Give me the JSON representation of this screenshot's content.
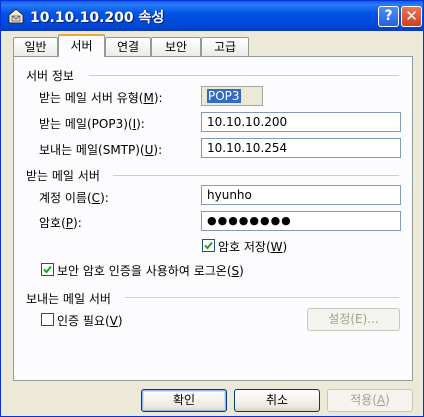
{
  "window": {
    "title": "10.10.10.200 속성",
    "help_glyph": "?",
    "close_glyph": "✕"
  },
  "tabs": [
    "일반",
    "서버",
    "연결",
    "보안",
    "고급"
  ],
  "server_info": {
    "heading": "서버 정보",
    "incoming_type": {
      "label_pre": "받는 메일 서버 유형(",
      "key": "M",
      "label_post": "):",
      "value": "POP3"
    },
    "incoming": {
      "label_pre": "받는 메일(POP3)(",
      "key": "I",
      "label_post": "):",
      "value": "10.10.10.200"
    },
    "outgoing": {
      "label_pre": "보내는 메일(SMTP)(",
      "key": "U",
      "label_post": "):",
      "value": "10.10.10.254"
    }
  },
  "incoming_server": {
    "heading": "받는 메일 서버",
    "account": {
      "label_pre": "계정 이름(",
      "key": "C",
      "label_post": "):",
      "value": "hyunho"
    },
    "password": {
      "label_pre": "암호(",
      "key": "P",
      "label_post": "):",
      "value": "●●●●●●●●"
    },
    "remember": {
      "label_pre": "암호 저장(",
      "key": "W",
      "label_post": ")",
      "checked": true
    },
    "spa": {
      "label_pre": "보안 암호 인증을 사용하여 로그온(",
      "key": "S",
      "label_post": ")",
      "checked": true
    }
  },
  "outgoing_server": {
    "heading": "보내는 메일 서버",
    "auth": {
      "label_pre": "인증 필요(",
      "key": "V",
      "label_post": ")",
      "checked": false
    },
    "settings_button": "설정(E)..."
  },
  "buttons": {
    "ok": "확인",
    "cancel": "취소",
    "apply_pre": "적용(",
    "apply_key": "A",
    "apply_post": ")"
  },
  "colors": {
    "title_bar": "#0055e5",
    "dialog_bg": "#ece9d8",
    "panel_bg": "#fcfcfe",
    "check_mark": "#21a121"
  }
}
